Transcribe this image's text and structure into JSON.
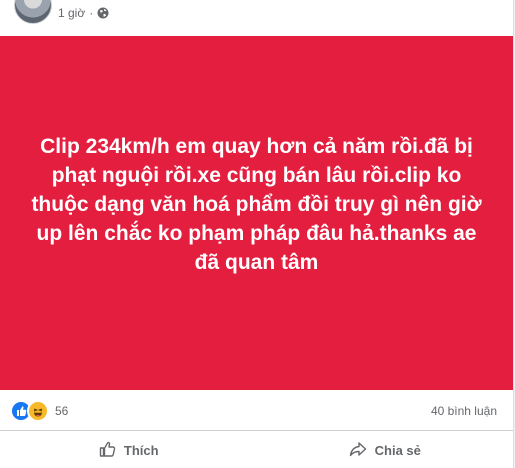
{
  "post": {
    "time": "1 giờ",
    "separator": "·",
    "background_color": "#e41e3f",
    "text": "Clip 234km/h em quay hơn cả năm rồi.đã bị phạt nguội rồi.xe cũng bán lâu rồi.clip ko thuộc dạng văn hoá phẩm đồi truy gì nên giờ up lên chắc ko phạm pháp đâu hả.thanks ae đã quan tâm"
  },
  "stats": {
    "reaction_icons": [
      "like-icon",
      "haha-icon"
    ],
    "reaction_count": "56",
    "comment_count": "40 bình luận"
  },
  "actions": {
    "like_label": "Thích",
    "share_label": "Chia sẻ"
  },
  "colors": {
    "accent": "#1877f2",
    "muted_text": "#65676b"
  }
}
